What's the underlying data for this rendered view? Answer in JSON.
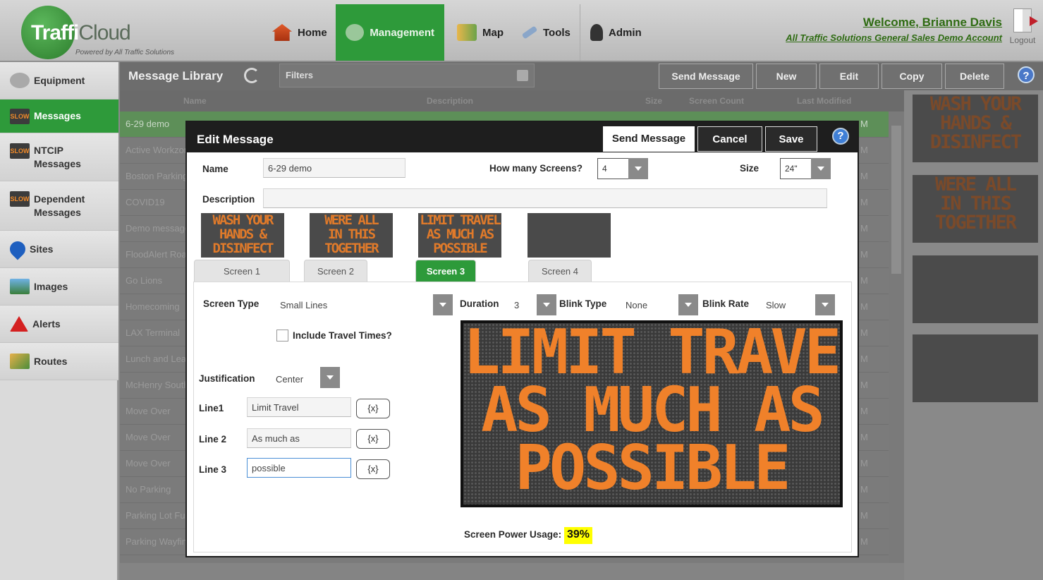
{
  "app": {
    "logo_primary": "Traffi",
    "logo_secondary": "Cloud",
    "logo_tagline": "Powered by All Traffic Solutions",
    "welcome": "Welcome, Brianne Davis",
    "account": "All Traffic Solutions General Sales Demo Account",
    "logout": "Logout"
  },
  "nav": {
    "home": "Home",
    "management": "Management",
    "map": "Map",
    "tools": "Tools",
    "admin": "Admin"
  },
  "sidebar": {
    "items": [
      {
        "label": "Equipment",
        "icon": "gear-icon"
      },
      {
        "label": "Messages",
        "icon": "slow-sign-icon"
      },
      {
        "label": "NTCIP Messages",
        "icon": "slow-sign-icon"
      },
      {
        "label": "Dependent Messages",
        "icon": "slow-sign-icon"
      },
      {
        "label": "Sites",
        "icon": "map-pin-icon"
      },
      {
        "label": "Images",
        "icon": "image-icon"
      },
      {
        "label": "Alerts",
        "icon": "alert-icon"
      },
      {
        "label": "Routes",
        "icon": "route-icon"
      }
    ]
  },
  "library": {
    "title": "Message Library",
    "filters_label": "Filters",
    "buttons": {
      "send": "Send Message",
      "new": "New",
      "edit": "Edit",
      "copy": "Copy",
      "delete": "Delete"
    },
    "columns": {
      "name": "Name",
      "description": "Description",
      "size": "Size",
      "screen_count": "Screen Count",
      "last_modified": "Last Modified"
    },
    "rows": [
      {
        "name": "6-29 demo",
        "mod": "M"
      },
      {
        "name": "Active Workzone",
        "mod": "M"
      },
      {
        "name": "Boston Parking",
        "mod": "M"
      },
      {
        "name": "COVID19",
        "mod": "M"
      },
      {
        "name": "Demo message",
        "mod": "M"
      },
      {
        "name": "FloodAlert Road",
        "mod": "M"
      },
      {
        "name": "Go Lions",
        "mod": "M"
      },
      {
        "name": "Homecoming",
        "mod": "M"
      },
      {
        "name": "LAX Terminal",
        "mod": "M"
      },
      {
        "name": "Lunch and Learn",
        "mod": "M"
      },
      {
        "name": "McHenry South",
        "mod": "M"
      },
      {
        "name": "Move Over",
        "mod": "M"
      },
      {
        "name": "Move Over",
        "mod": "M"
      },
      {
        "name": "Move Over",
        "mod": "M"
      },
      {
        "name": "No Parking",
        "mod": "M"
      },
      {
        "name": "Parking Lot Full",
        "mod": "M"
      },
      {
        "name": "Parking Wayfinding",
        "mod": "M"
      }
    ],
    "previews": [
      {
        "lines": [
          "WASH YOUR",
          "HANDS &",
          "DISINFECT"
        ]
      },
      {
        "lines": [
          "WERE ALL",
          "IN THIS",
          "TOGETHER"
        ]
      },
      {
        "lines": []
      },
      {
        "lines": []
      }
    ]
  },
  "modal": {
    "title": "Edit Message",
    "buttons": {
      "send": "Send Message",
      "cancel": "Cancel",
      "save": "Save",
      "help": "?"
    },
    "name_label": "Name",
    "name_value": "6-29 demo",
    "screens_label": "How many Screens?",
    "screens_value": "4",
    "size_label": "Size",
    "size_value": "24\"",
    "description_label": "Description",
    "description_value": "",
    "screens": [
      {
        "tab": "Screen 1",
        "lines": [
          "WASH YOUR",
          "HANDS &",
          "DISINFECT"
        ]
      },
      {
        "tab": "Screen 2",
        "lines": [
          "WERE ALL",
          "IN THIS",
          "TOGETHER"
        ]
      },
      {
        "tab": "Screen 3",
        "lines": [
          "LIMIT TRAVEL",
          "AS MUCH AS",
          "POSSIBLE"
        ]
      },
      {
        "tab": "Screen 4",
        "lines": []
      }
    ],
    "active_screen": "Screen 3",
    "screen_type_label": "Screen Type",
    "screen_type_value": "Small Lines",
    "duration_label": "Duration",
    "duration_value": "3",
    "blink_type_label": "Blink Type",
    "blink_type_value": "None",
    "blink_rate_label": "Blink Rate",
    "blink_rate_value": "Slow",
    "include_travel_label": "Include Travel Times?",
    "justification_label": "Justification",
    "justification_value": "Center",
    "lines": [
      {
        "label": "Line1",
        "value": "Limit Travel",
        "var_button": "{x}"
      },
      {
        "label": "Line 2",
        "value": "As much as",
        "var_button": "{x}"
      },
      {
        "label": "Line 3",
        "value": "possible",
        "var_button": "{x}"
      }
    ],
    "sign_lines": [
      "LIMIT TRAVEL",
      "AS MUCH AS",
      "POSSIBLE"
    ],
    "power_label": "Screen Power Usage:",
    "power_value": "39%"
  },
  "colors": {
    "accent_green": "#2e9a3a",
    "sign_amber": "#f0812a",
    "power_highlight": "#ffff00"
  }
}
